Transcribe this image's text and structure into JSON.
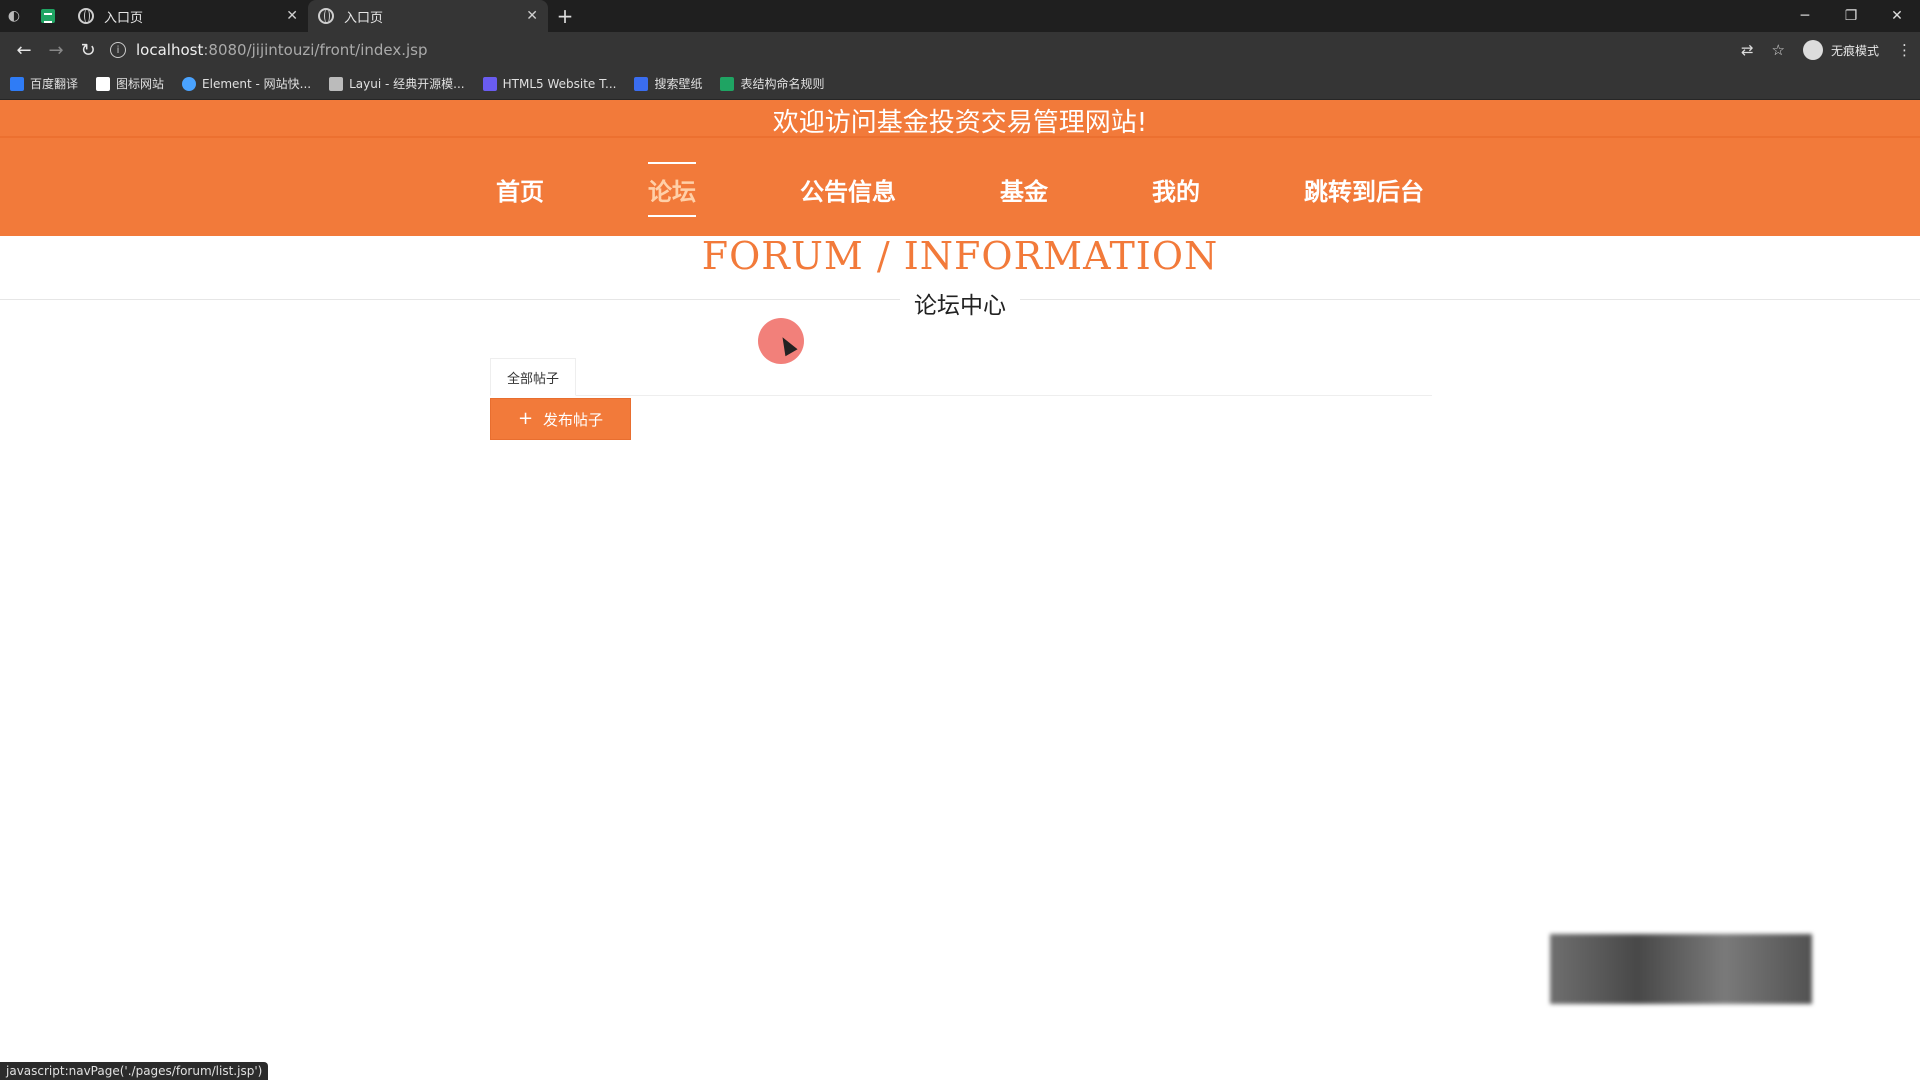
{
  "browser": {
    "tabs": [
      {
        "title": "入口页"
      },
      {
        "title": "入口页"
      }
    ],
    "url_host": "localhost",
    "url_rest": ":8080/jijintouzi/front/index.jsp",
    "profile_label": "无痕模式",
    "bookmarks": [
      "百度翻译",
      "图标网站",
      "Element - 网站快...",
      "Layui - 经典开源模...",
      "HTML5 Website T...",
      "搜索壁纸",
      "表结构命名规则"
    ],
    "status_text": "javascript:navPage('./pages/forum/list.jsp')"
  },
  "header": {
    "welcome": "欢迎访问基金投资交易管理网站!",
    "menu": [
      "首页",
      "论坛",
      "公告信息",
      "基金",
      "我的",
      "跳转到后台"
    ],
    "active_index": 1
  },
  "section": {
    "title": "FORUM / INFORMATION",
    "subtitle": "论坛中心"
  },
  "forum": {
    "tab_all": "全部帖子",
    "publish_label": "发布帖子"
  },
  "colors": {
    "brand": "#f27a3a",
    "active_menu": "#ffd0a8"
  }
}
